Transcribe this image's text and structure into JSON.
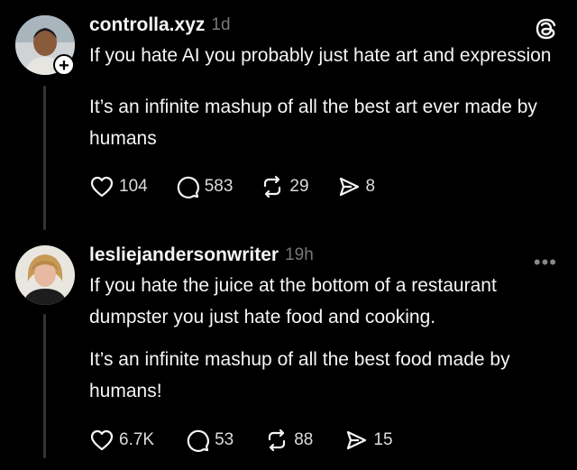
{
  "posts": [
    {
      "username": "controlla.xyz",
      "time": "1d",
      "paragraphs": [
        "If you hate AI you probably just hate art and expression",
        "It’s an infinite mashup of all the best art ever made by humans"
      ],
      "likes": "104",
      "comments": "583",
      "reposts": "29",
      "shares": "8"
    },
    {
      "username": "lesliejandersonwriter",
      "time": "19h",
      "paragraphs": [
        "If you hate the juice at the bottom of a restaurant dumpster you just hate food and cooking.",
        "It’s an infinite mashup of all the best food made by humans!"
      ],
      "likes": "6.7K",
      "comments": "53",
      "reposts": "88",
      "shares": "15"
    }
  ],
  "icons": {
    "follow": "plus-icon",
    "brand": "threads-logo-icon",
    "more": "more-dots-icon",
    "like": "heart-icon",
    "comment": "comment-bubble-icon",
    "repost": "repost-icon",
    "share": "send-icon"
  },
  "colors": {
    "background": "#000000",
    "text": "#f3f5f7",
    "muted": "#777777"
  }
}
